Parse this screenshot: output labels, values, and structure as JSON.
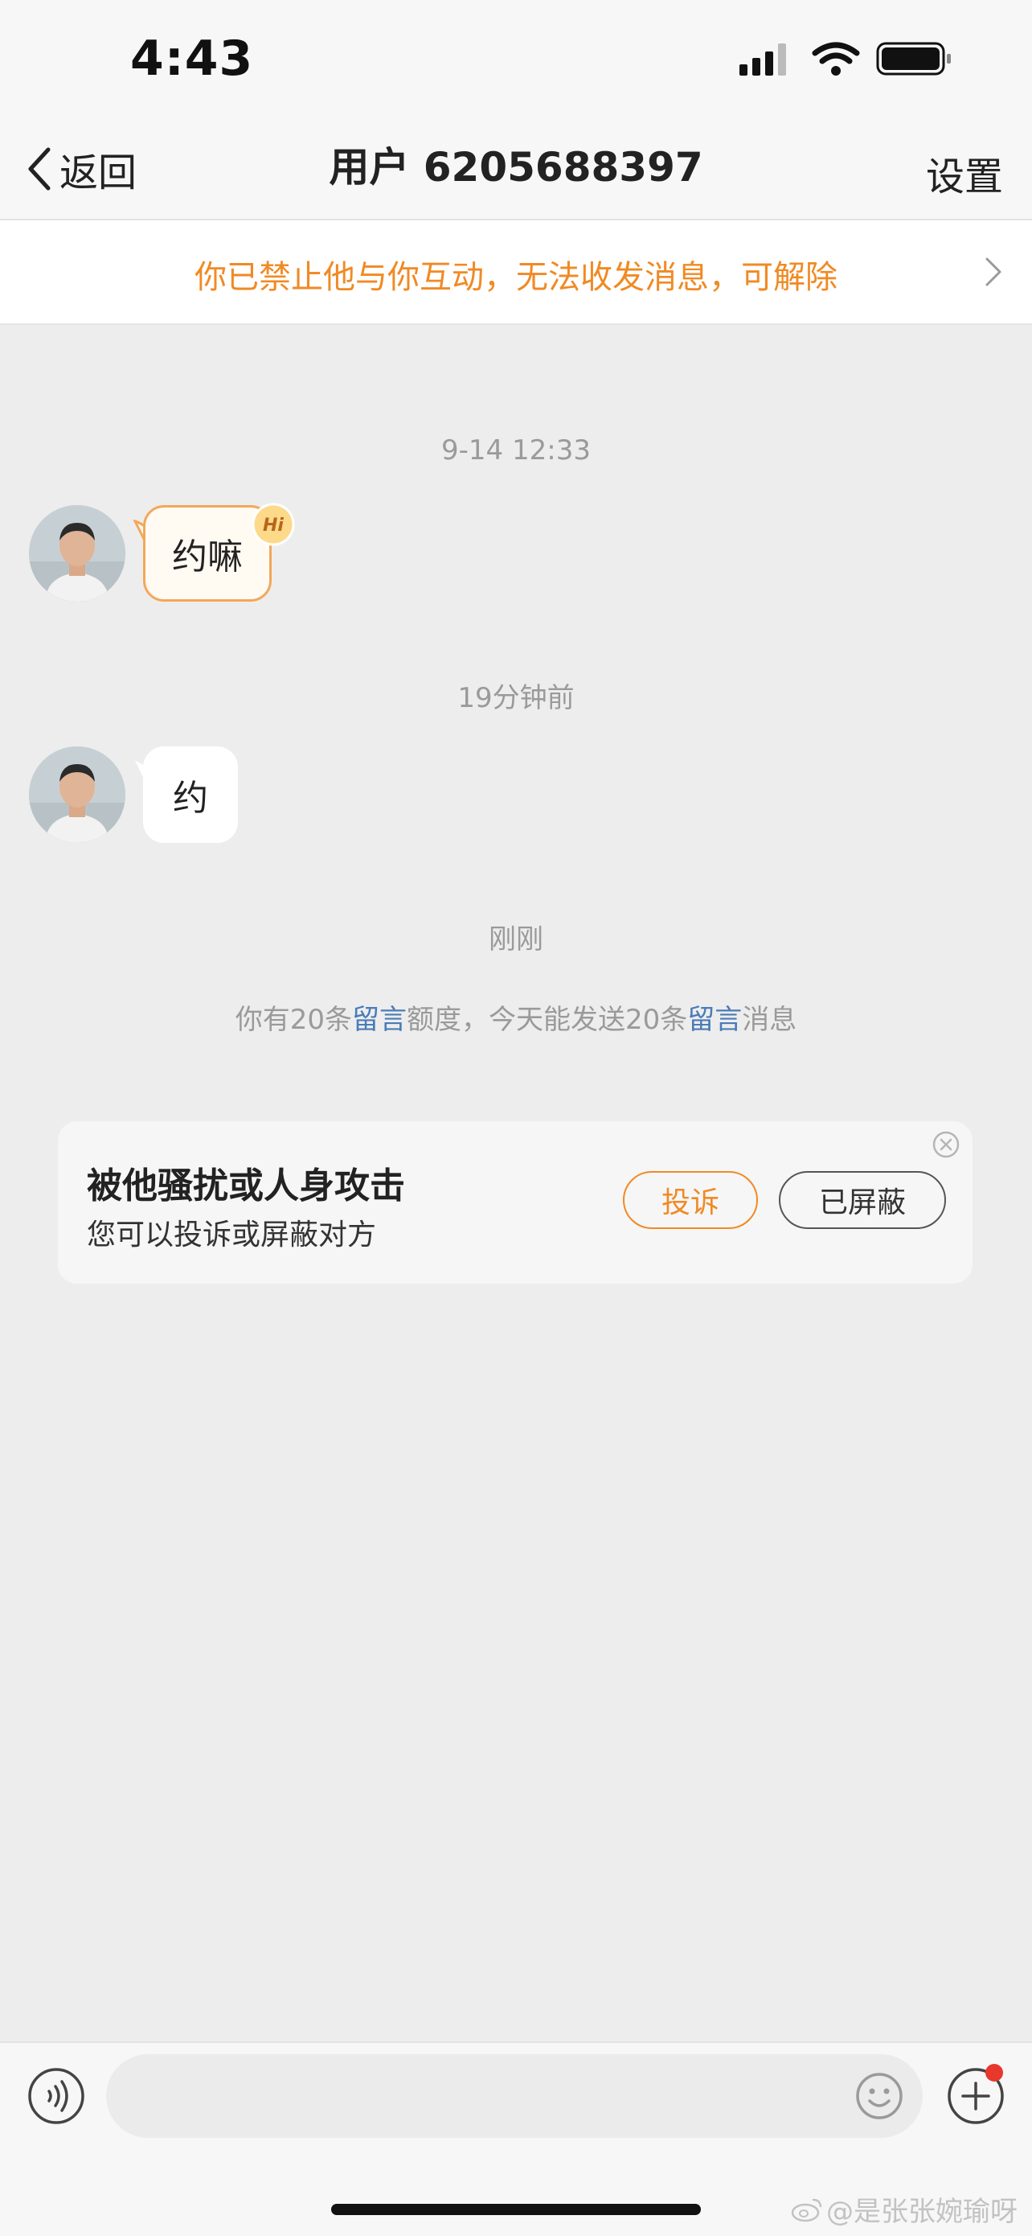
{
  "status_bar": {
    "time": "4:43"
  },
  "nav": {
    "back_label": "返回",
    "title": "用户 6205688397",
    "settings_label": "设置"
  },
  "banner": {
    "text": "你已禁止他与你互动，无法收发消息，可解除"
  },
  "messages": [
    {
      "timestamp": "9-14 12:33",
      "text": "约嘛",
      "badge": "Hi"
    },
    {
      "timestamp": "19分钟前",
      "text": "约"
    }
  ],
  "system": {
    "timestamp": "刚刚",
    "quota_prefix": "你有20条",
    "quota_link1": "留言",
    "quota_middle": "额度，今天能发送20条",
    "quota_link2": "留言",
    "quota_suffix": "消息"
  },
  "safety_card": {
    "title": "被他骚扰或人身攻击",
    "subtitle": "您可以投诉或屏蔽对方",
    "complain_label": "投诉",
    "blocked_label": "已屏蔽"
  },
  "input": {
    "value": "",
    "placeholder": ""
  },
  "watermark": "@是张张婉瑜呀",
  "colors": {
    "accent": "#f08a24",
    "link": "#4a7bb8",
    "background": "#ededed",
    "badge_red": "#e8372c"
  }
}
